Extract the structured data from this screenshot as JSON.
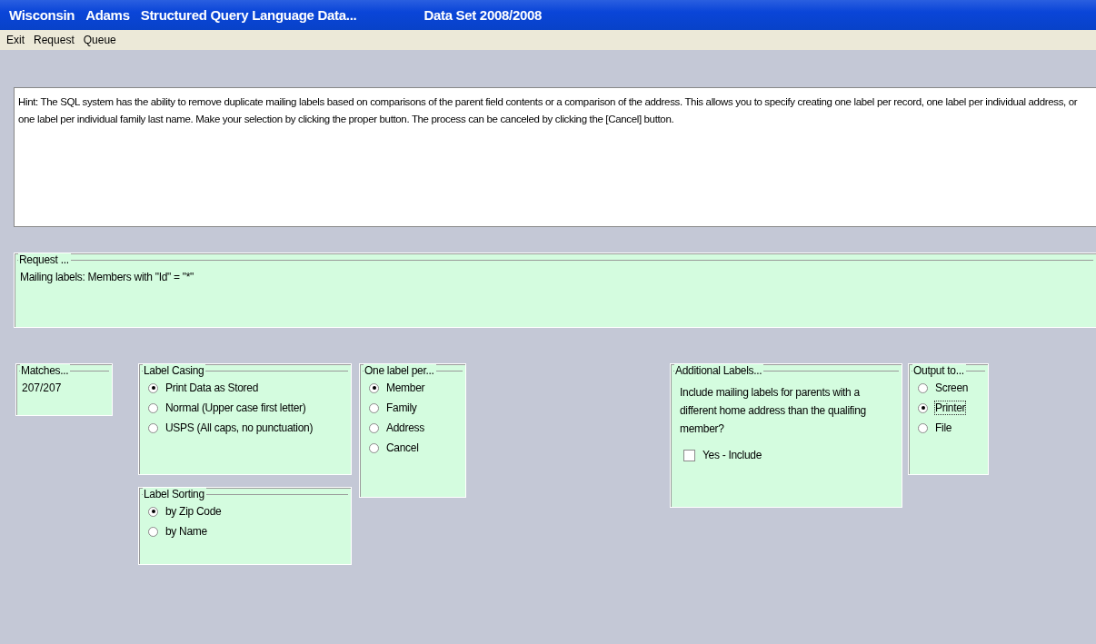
{
  "window": {
    "title_parts": [
      "Wisconsin",
      "Adams",
      "Structured Query Language Data..."
    ],
    "data_set": "Data Set 2008/2008"
  },
  "menu": [
    "Exit",
    "Request",
    "Queue"
  ],
  "hint": "Hint:  The SQL system has the ability to remove duplicate mailing labels based on comparisons of the parent field contents or a comparison of the address.  This allows you to specify creating one label per record, one label per individual address, or one label per individual family last name.  Make your selection by clicking the proper button.  The process can be canceled by clicking the [Cancel] button.",
  "request": {
    "title": "Request ...",
    "text": "Mailing labels: Members with \"Id\" = \"*\""
  },
  "matches": {
    "title": "Matches...",
    "value": "207/207"
  },
  "label_casing": {
    "title": "Label Casing",
    "options": [
      {
        "label": "Print Data as Stored",
        "selected": true
      },
      {
        "label": "Normal (Upper case first letter)",
        "selected": false
      },
      {
        "label": "USPS (All caps, no punctuation)",
        "selected": false
      }
    ]
  },
  "label_sorting": {
    "title": "Label Sorting",
    "options": [
      {
        "label": "by Zip Code",
        "selected": true
      },
      {
        "label": "by Name",
        "selected": false
      }
    ]
  },
  "one_label_per": {
    "title": "One label per...",
    "options": [
      {
        "label": "Member",
        "selected": true
      },
      {
        "label": "Family",
        "selected": false
      },
      {
        "label": "Address",
        "selected": false
      },
      {
        "label": "Cancel",
        "selected": false
      }
    ]
  },
  "additional_labels": {
    "title": "Additional Labels...",
    "text": "Include mailing labels for parents with a different home address than the qualifing member?",
    "checkbox": {
      "label": "Yes - Include",
      "checked": false
    }
  },
  "output_to": {
    "title": "Output to...",
    "options": [
      {
        "label": "Screen",
        "selected": false,
        "focused": false
      },
      {
        "label": "Printer",
        "selected": true,
        "focused": true
      },
      {
        "label": "File",
        "selected": false,
        "focused": false
      }
    ]
  }
}
